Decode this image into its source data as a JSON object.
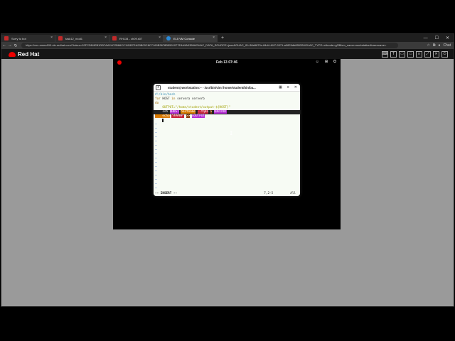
{
  "browser": {
    "tabs": [
      {
        "label": "Sorry to bot",
        "color": "#c12a2a"
      },
      {
        "label": "task12_mod1",
        "color": "#c12a2a"
      },
      {
        "label": "RH134 - ch09.s07",
        "color": "#c12a2a"
      },
      {
        "label": "EL5 VM Console",
        "color": "#2a8ad8"
      }
    ],
    "active_tab": 3,
    "new_tab": "+",
    "url": "https://vnc-emea100.ole.redhat.com/?token=92FCDB4EB1DB7AA24C2B66CC11DB7EA29B00C8C7169B3678B5591077E4A9A0356&GUAC_DATA_SOURCE=json&GUAC_ID=38a5879c-84d4-4f47-9371-a0829db65532&GUAC_TYPE=c&node=g338vm_name=workstation&username=",
    "profile_label": "Chat"
  },
  "redhat": {
    "brand": "Red Hat"
  },
  "gnome": {
    "datetime": "Feb 13  07:46"
  },
  "terminal": {
    "title": "student@workstation:~ - /usr/bin/vim /home/student/bin/ba...",
    "lines": {
      "l1": "#!/bin/bash",
      "l2a": "for",
      "l2b": " HOST ",
      "l2c": "in",
      "l2d": " servera serverb",
      "l3": "do",
      "l4a": "    OUTPUT=\"/home/student/output-${HOST}\"",
      "l5a": "    ssh",
      "l5b": "$HOST",
      "l5c": "hostname",
      "l5d": "--fqdn",
      "l5e": ">",
      "l5f": "$OUTPUT",
      "l6a": "    echo",
      "l6b": "\"#####\"",
      "l6c": ">>",
      "l6d": "$OUTPUT"
    },
    "tildes": [
      "~",
      "~",
      "~",
      "~",
      "~",
      "~",
      "~",
      "~",
      "~",
      "~",
      "~",
      "~",
      "~",
      "~",
      "~",
      "~"
    ],
    "mode": "-- INSERT --",
    "position": "7,2-5",
    "percent": "All"
  }
}
